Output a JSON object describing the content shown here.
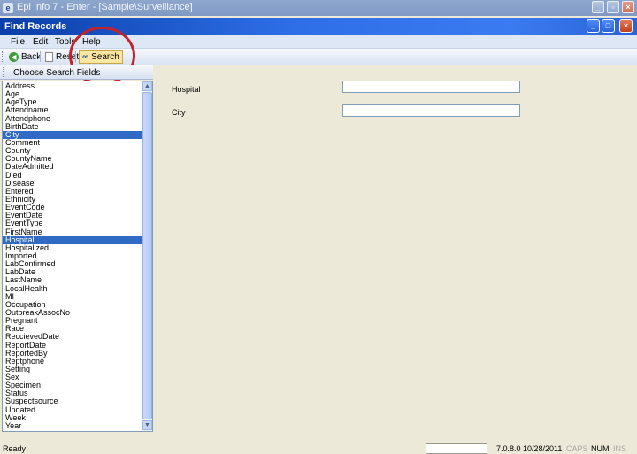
{
  "window": {
    "title": "Epi Info 7 - Enter - [Sample\\Surveillance]",
    "app_icon": "e"
  },
  "dialog": {
    "title": "Find Records"
  },
  "menu": [
    "File",
    "Edit",
    "Tools",
    "Help"
  ],
  "toolbar": {
    "back_label": "Back",
    "reset_label": "Reset",
    "search_label": "Search"
  },
  "panel": {
    "header": "Choose Search Fields",
    "fields": [
      "Address",
      "Age",
      "AgeType",
      "Attendname",
      "Attendphone",
      "BirthDate",
      "City",
      "Comment",
      "County",
      "CountyName",
      "DateAdmitted",
      "Died",
      "Disease",
      "Entered",
      "Ethnicity",
      "EventCode",
      "EventDate",
      "EventType",
      "FirstName",
      "Hospital",
      "Hospitalized",
      "Imported",
      "LabConfirmed",
      "LabDate",
      "LastName",
      "LocalHealth",
      "MI",
      "Occupation",
      "OutbreakAssocNo",
      "Pregnant",
      "Race",
      "ReccievedDate",
      "ReportDate",
      "ReportedBy",
      "Reptphone",
      "Setting",
      "Sex",
      "Specimen",
      "Status",
      "Suspectsource",
      "Updated",
      "Week",
      "Year"
    ],
    "selected": [
      "City",
      "Hospital"
    ]
  },
  "form": {
    "hospital_label": "Hospital",
    "hospital_value": "",
    "city_label": "City",
    "city_value": ""
  },
  "status": {
    "text": "Ready",
    "version": "7.0.8.0",
    "date": "10/28/2011",
    "caps": "CAPS",
    "num": "NUM",
    "ins": "INS"
  },
  "colors": {
    "selection": "#316ac5",
    "dialog_title": "#2d6ee6",
    "highlight_ring": "#c0232a"
  }
}
